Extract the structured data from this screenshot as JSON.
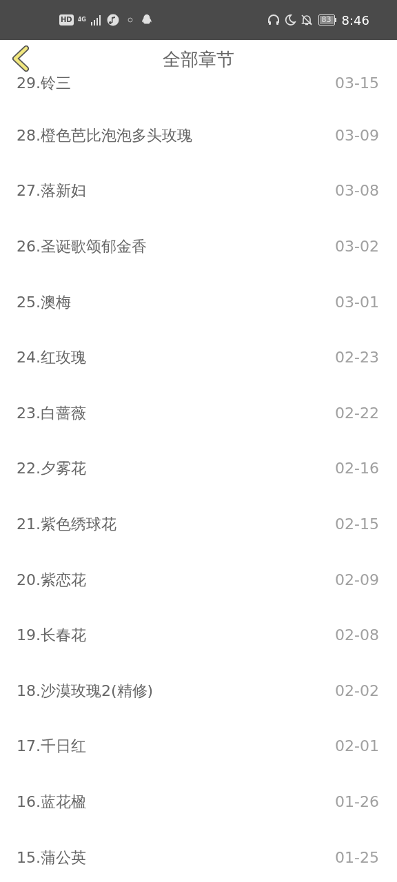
{
  "status_bar": {
    "hd": "HD",
    "network": "4G",
    "battery": "83",
    "time": "8:46"
  },
  "header": {
    "title": "全部章节"
  },
  "chapters": [
    {
      "title": "29.铃三",
      "date": "03-15"
    },
    {
      "title": "28.橙色芭比泡泡多头玫瑰",
      "date": "03-09"
    },
    {
      "title": "27.落新妇",
      "date": "03-08"
    },
    {
      "title": "26.圣诞歌颂郁金香",
      "date": "03-02"
    },
    {
      "title": "25.澳梅",
      "date": "03-01"
    },
    {
      "title": "24.红玫瑰",
      "date": "02-23"
    },
    {
      "title": "23.白蔷薇",
      "date": "02-22"
    },
    {
      "title": "22.夕雾花",
      "date": "02-16"
    },
    {
      "title": "21.紫色绣球花",
      "date": "02-15"
    },
    {
      "title": "20.紫恋花",
      "date": "02-09"
    },
    {
      "title": "19.长春花",
      "date": "02-08"
    },
    {
      "title": "18.沙漠玫瑰2(精修)",
      "date": "02-02"
    },
    {
      "title": "17.千日红",
      "date": "02-01"
    },
    {
      "title": "16.蓝花楹",
      "date": "01-26"
    },
    {
      "title": "15.蒲公英",
      "date": "01-25"
    }
  ]
}
